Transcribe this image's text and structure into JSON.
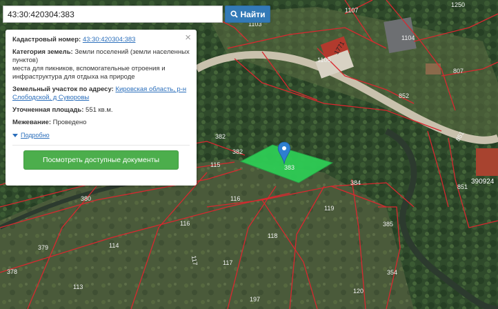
{
  "search": {
    "value": "43:30:420304:383",
    "button_label": "Найти"
  },
  "panel": {
    "close_symbol": "×",
    "cadastral_label": "Кадастровый номер:",
    "cadastral_value": "43:30:420304:383",
    "category_label": "Категория земель:",
    "category_value": "Земли поселений (земли населенных пунктов)",
    "category_detail": "места для пикников, вспомогательные отроения и инфраструктура для отдыха на природе",
    "address_label": "Земельный участок по адресу:",
    "address_value": "Кировская область, р-н Слободской, д Суворовы",
    "area_label": "Уточненная площадь:",
    "area_value": "551 кв.м.",
    "survey_label": "Межевание:",
    "survey_value": "Проведено",
    "more_label": "Подробно",
    "docs_button": "Посмотреть доступные документы"
  },
  "map": {
    "marker": "location-pin-icon",
    "highlight_color": "#2ecc55",
    "boundary_color": "#d9282f",
    "plot_labels": [
      "1107",
      "1250",
      "1103",
      "1104",
      "1771",
      "1106",
      "807",
      "852",
      "382",
      "382",
      "115",
      "383",
      "851",
      "384",
      "851",
      "380",
      "116",
      "119",
      "116",
      "385",
      "379",
      "114",
      "118",
      "378",
      "117",
      "117",
      "354",
      "113",
      "120",
      "197"
    ],
    "partial_label": "390924"
  }
}
